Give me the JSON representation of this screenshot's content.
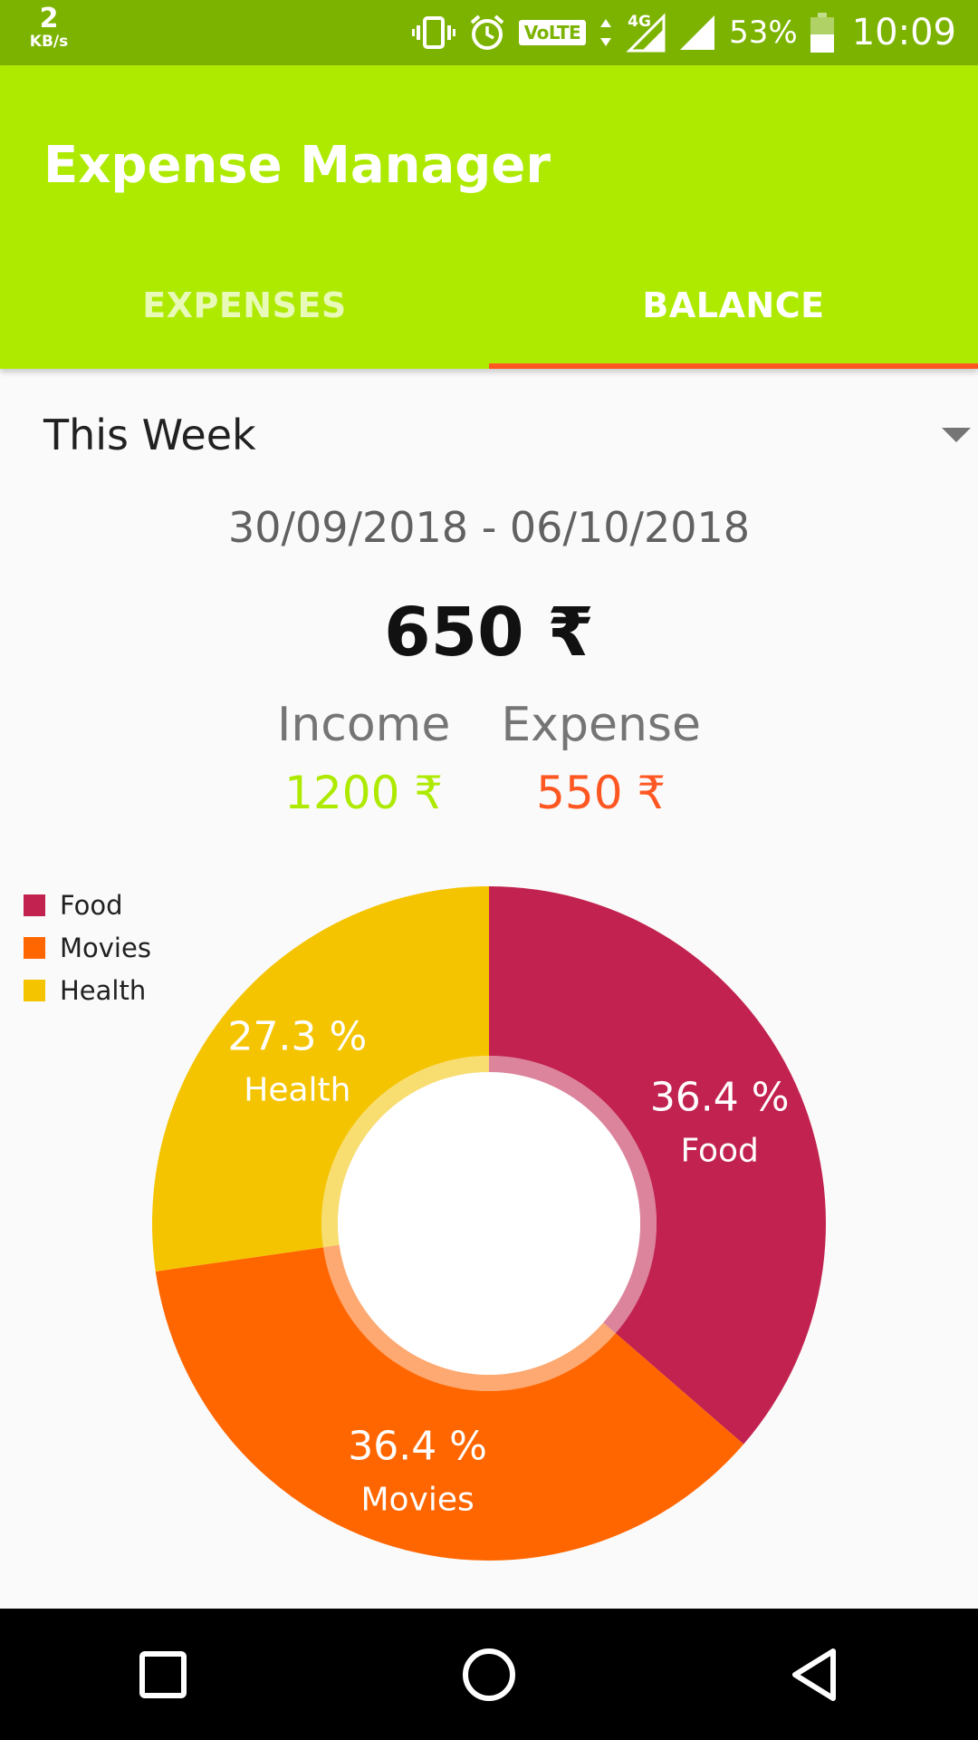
{
  "status_bar": {
    "speed_value": "2",
    "speed_unit": "KB/s",
    "volte": "VoLTE",
    "network": "4G",
    "battery": "53%",
    "time": "10:09"
  },
  "app": {
    "title": "Expense Manager",
    "accent": "#aeea00",
    "indicator": "#ff5722"
  },
  "tabs": [
    {
      "label": "EXPENSES",
      "active": false
    },
    {
      "label": "BALANCE",
      "active": true
    }
  ],
  "period": {
    "selected": "This Week",
    "date_range": "30/09/2018 - 06/10/2018"
  },
  "balance": "650 ₹",
  "income": {
    "label": "Income",
    "value": "1200 ₹"
  },
  "expense": {
    "label": "Expense",
    "value": "550 ₹"
  },
  "chart_data": {
    "type": "pie",
    "categories": [
      "Food",
      "Movies",
      "Health"
    ],
    "values": [
      36.4,
      36.4,
      27.3
    ],
    "value_labels": [
      "36.4 %",
      "36.4 %",
      "27.3 %"
    ],
    "colors": [
      "#c2224f",
      "#ff6600",
      "#f5c400"
    ],
    "legend_position": "top-left",
    "donut": true
  },
  "nav": {
    "recents": "square-icon",
    "home": "circle-icon",
    "back": "triangle-icon"
  }
}
